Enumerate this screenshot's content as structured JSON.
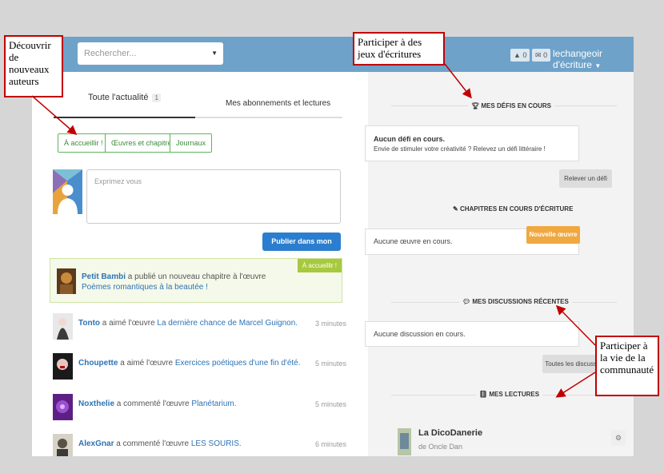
{
  "header": {
    "search_placeholder": "Rechercher...",
    "notif_count": "0",
    "msg_count": "0",
    "username": "lechangeoir d'écriture"
  },
  "tabs": {
    "all": "Toute l'actualité",
    "all_count": "1",
    "subs": "Mes abonnements et lectures"
  },
  "filters": [
    "À accueillir !",
    "Œuvres et chapitres",
    "Journaux"
  ],
  "composer": {
    "placeholder": "Exprimez vous",
    "publish": "Publier dans mon journal"
  },
  "featured": {
    "tag": "À accueillir !",
    "author": "Petit Bambi",
    "text1": " a publié un nouveau chapitre à l'œuvre ",
    "work": "Poèmes romantiques à la beautée !",
    "end": "."
  },
  "feed": [
    {
      "author": "Tonto",
      "action": " a aimé l'œuvre ",
      "work": "La dernière chance de Marcel Guignon.",
      "time": "3 minutes"
    },
    {
      "author": "Choupette",
      "action": " a aimé l'œuvre ",
      "work": "Exercices poétiques d'une fin d'été.",
      "time": "5 minutes"
    },
    {
      "author": "Noxthelie",
      "action": " a commenté l'œuvre ",
      "work": "Planétarium.",
      "time": "5 minutes"
    },
    {
      "author": "AlexGnar",
      "action": " a commenté l'œuvre ",
      "work": "LES SOURIS.",
      "time": "6 minutes"
    }
  ],
  "right": {
    "defis_title": "MES DÉFIS EN COURS",
    "defis_none": "Aucun défi en cours.",
    "defis_msg": "Envie de stimuler votre créativité ? Relevez un défi littéraire !",
    "defis_btn": "Relever un défi",
    "chap_title": "CHAPITRES EN COURS D'ÉCRITURE",
    "chap_none": "Aucune œuvre en cours.",
    "chap_btn": "Nouvelle œuvre",
    "disc_title": "MES DISCUSSIONS RÉCENTES",
    "disc_none": "Aucune discussion en cours.",
    "disc_btn": "Toutes les discussions",
    "lect_title": "MES LECTURES",
    "book_title": "La DicoDanerie",
    "book_author": "de Oncle Dan"
  },
  "annotations": {
    "decouvrir": "Découvrir de nouveaux auteurs",
    "participer_jeux": "Participer à des jeux d'écritures",
    "participer_vie": "Participer à la vie de la communauté"
  },
  "colors": {
    "topbar": "#6ea2c9",
    "publish": "#2b7ecf",
    "orange": "#f0a840",
    "callout_border": "#c00000"
  }
}
